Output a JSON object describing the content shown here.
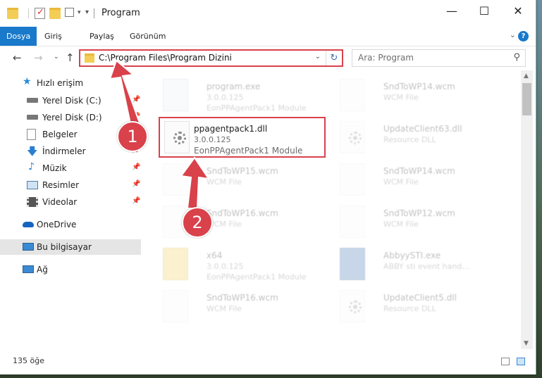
{
  "window": {
    "title": "Program",
    "controls": {
      "minimize": "—",
      "maximize": "☐",
      "close": "✕"
    }
  },
  "ribbon": {
    "tabs": [
      "Dosya",
      "Giriş",
      "Paylaş",
      "Görünüm"
    ]
  },
  "address_bar": {
    "path": "C:\\Program Files\\Program Dizini"
  },
  "search": {
    "placeholder": "Ara: Program"
  },
  "sidebar": {
    "items": [
      {
        "label": "Hızlı erişim",
        "icon": "star-icon"
      },
      {
        "label": "Yerel Disk (C:)",
        "icon": "drive-icon"
      },
      {
        "label": "Yerel Disk (D:)",
        "icon": "drive-icon"
      },
      {
        "label": "Belgeler",
        "icon": "documents-icon"
      },
      {
        "label": "İndirmeler",
        "icon": "download-icon"
      },
      {
        "label": "Müzik",
        "icon": "music-icon"
      },
      {
        "label": "Resimler",
        "icon": "pictures-icon"
      },
      {
        "label": "Videolar",
        "icon": "video-icon"
      },
      {
        "label": "OneDrive",
        "icon": "cloud-icon"
      },
      {
        "label": "Bu bilgisayar",
        "icon": "computer-icon"
      },
      {
        "label": "Ağ",
        "icon": "network-icon"
      }
    ]
  },
  "files": [
    {
      "name": "program.exe",
      "line2": "3.0.0.125",
      "line3": "EonPPAgentPack1 Module"
    },
    {
      "name": "SndToWP14.wcm",
      "line2": "WCM File",
      "line3": ""
    },
    {
      "name": "ppagentpack1.dll",
      "line2": "3.0.0.125",
      "line3": "EonPPAgentPack1 Module"
    },
    {
      "name": "UpdateClient63.dll",
      "line2": "Resource DLL",
      "line3": ""
    },
    {
      "name": "SndToWP15.wcm",
      "line2": "WCM File",
      "line3": ""
    },
    {
      "name": "SndToWP14.wcm",
      "line2": "WCM File",
      "line3": ""
    },
    {
      "name": "SndToWP16.wcm",
      "line2": "WCM File",
      "line3": ""
    },
    {
      "name": "SndToWP12.wcm",
      "line2": "WCM File",
      "line3": ""
    },
    {
      "name": "x64",
      "line2": "3.0.0.125",
      "line3": "EonPPAgentPack1 Module"
    },
    {
      "name": "AbbyySTI.exe",
      "line2": "ABBY sti event hand...",
      "line3": ""
    },
    {
      "name": "SndToWP16.wcm",
      "line2": "WCM File",
      "line3": ""
    },
    {
      "name": "UpdateClient5.dll",
      "line2": "Resource DLL",
      "line3": ""
    }
  ],
  "status": {
    "item_count": "135 öğe"
  },
  "annotations": {
    "step1": "1",
    "step2": "2",
    "color": "#d9414b"
  }
}
